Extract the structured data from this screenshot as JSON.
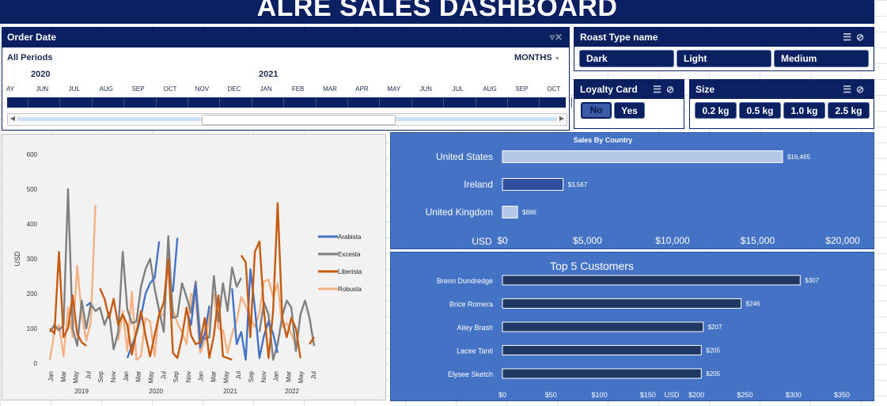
{
  "title": "ALRE SALES DASHBOARD",
  "timeline": {
    "header": "Order Date",
    "period_label": "All Periods",
    "level": "MONTHS",
    "years": [
      {
        "label": "2020"
      },
      {
        "label": "2021"
      }
    ],
    "months": [
      "AY",
      "JUN",
      "JUL",
      "AUG",
      "SEP",
      "OCT",
      "NOV",
      "DEC",
      "JAN",
      "FEB",
      "MAR",
      "APR",
      "MAY",
      "JUN",
      "JUL",
      "AUG",
      "SEP",
      "OCT"
    ]
  },
  "roast_slicer": {
    "header": "Roast Type name",
    "items": [
      "Dark",
      "Light",
      "Medium"
    ]
  },
  "loyalty_slicer": {
    "header": "Loyalty Card",
    "items": [
      "No",
      "Yes"
    ],
    "selected": "No"
  },
  "size_slicer": {
    "header": "Size",
    "items": [
      "0.2 kg",
      "0.5 kg",
      "1.0 kg",
      "2.5 kg"
    ]
  },
  "colors": {
    "navy": "#0a2060",
    "panel_blue": "#4472c4",
    "arabista": "#4472c4",
    "excesta": "#7f7f7f",
    "liberista": "#c55a11",
    "robusta": "#f4b183"
  },
  "chart_data": [
    {
      "type": "line",
      "ylabel": "USD",
      "ylim": [
        0,
        600
      ],
      "yticks": [
        0,
        100,
        200,
        300,
        400,
        500,
        600
      ],
      "xlabels": [
        "Jan",
        "Mar",
        "May",
        "Jul",
        "Sep",
        "Nov",
        "Jan",
        "Mar",
        "May",
        "Jul",
        "Sep",
        "Nov",
        "Jan",
        "Mar",
        "May",
        "Jul",
        "Sep",
        "Nov",
        "Jan",
        "Mar",
        "May",
        "Jul"
      ],
      "years": [
        "2019",
        "2020",
        "2021",
        "2022"
      ],
      "legend": "right",
      "series": [
        {
          "name": "Arabista",
          "values": [
            null,
            null,
            null,
            null,
            null,
            null,
            null,
            null,
            165,
            175,
            null,
            null,
            null,
            null,
            null,
            250,
            null,
            15,
            50,
            85,
            135,
            200,
            230,
            245,
            350,
            null,
            null,
            205,
            360,
            null,
            150,
            110,
            225,
            45,
            85,
            165,
            null,
            null,
            150,
            null,
            215,
            55,
            90,
            10,
            270,
            160,
            15,
            80,
            120,
            85,
            30
          ]
        },
        {
          "name": "Excesta",
          "values": [
            90,
            110,
            95,
            110,
            500,
            100,
            50,
            180,
            100,
            170,
            150,
            160,
            110,
            145,
            40,
            90,
            320,
            155,
            115,
            120,
            220,
            270,
            300,
            215,
            150,
            90,
            365,
            130,
            135,
            230,
            190,
            145,
            235,
            80,
            70,
            75,
            250,
            120,
            230,
            150,
            275,
            220,
            245,
            null,
            null,
            null,
            90,
            175,
            140,
            10,
            55,
            135,
            180,
            160,
            35,
            140,
            180,
            130,
            50
          ]
        },
        {
          "name": "Liberista",
          "values": [
            100,
            85,
            320,
            75,
            100,
            195,
            85,
            60,
            50,
            null,
            null,
            215,
            185,
            130,
            185,
            110,
            140,
            110,
            25,
            90,
            150,
            80,
            20,
            80,
            140,
            175,
            300,
            30,
            15,
            75,
            160,
            80,
            55,
            60,
            130,
            15,
            80,
            195,
            20,
            15,
            10,
            null,
            310,
            290,
            75,
            320,
            350,
            150,
            15,
            150,
            460,
            130,
            75,
            130,
            100,
            15,
            null,
            55,
            75
          ]
        },
        {
          "name": "Robusta",
          "values": [
            10,
            90,
            110,
            20,
            160,
            75,
            280,
            140,
            65,
            120,
            455,
            null,
            null,
            null,
            null,
            65,
            150,
            35,
            205,
            10,
            20,
            130,
            120,
            20,
            150,
            135,
            300,
            155,
            115,
            90,
            55,
            200,
            180,
            30,
            65,
            130,
            200,
            100,
            95,
            30,
            85,
            120,
            190,
            165,
            130,
            105,
            145,
            235,
            240,
            190,
            230,
            105,
            115,
            85,
            50
          ]
        }
      ]
    },
    {
      "type": "bar",
      "title": "Sales By Country",
      "categories": [
        "United States",
        "Ireland",
        "United Kingdom"
      ],
      "values": [
        16465,
        3567,
        886
      ],
      "value_labels": [
        "$16,465",
        "$3,567",
        "$886"
      ],
      "xlabel": "USD",
      "xticks": [
        "$0",
        "$5,000",
        "$10,000",
        "$15,000",
        "$20,000"
      ],
      "xlim": [
        0,
        20000
      ]
    },
    {
      "type": "bar",
      "title": "Top 5 Customers",
      "categories": [
        "Brenn Dundredge",
        "Brice Romera",
        "Ailey Brash",
        "Lacee Tanti",
        "Elysee Sketch"
      ],
      "values": [
        307,
        246,
        207,
        205,
        205
      ],
      "value_labels": [
        "$307",
        "$246",
        "$207",
        "$205",
        "$205"
      ],
      "xlabel": "USD",
      "xticks": [
        "$0",
        "$50",
        "$100",
        "$150",
        "$200",
        "$250",
        "$300",
        "$350"
      ],
      "xlim": [
        0,
        350
      ]
    }
  ]
}
